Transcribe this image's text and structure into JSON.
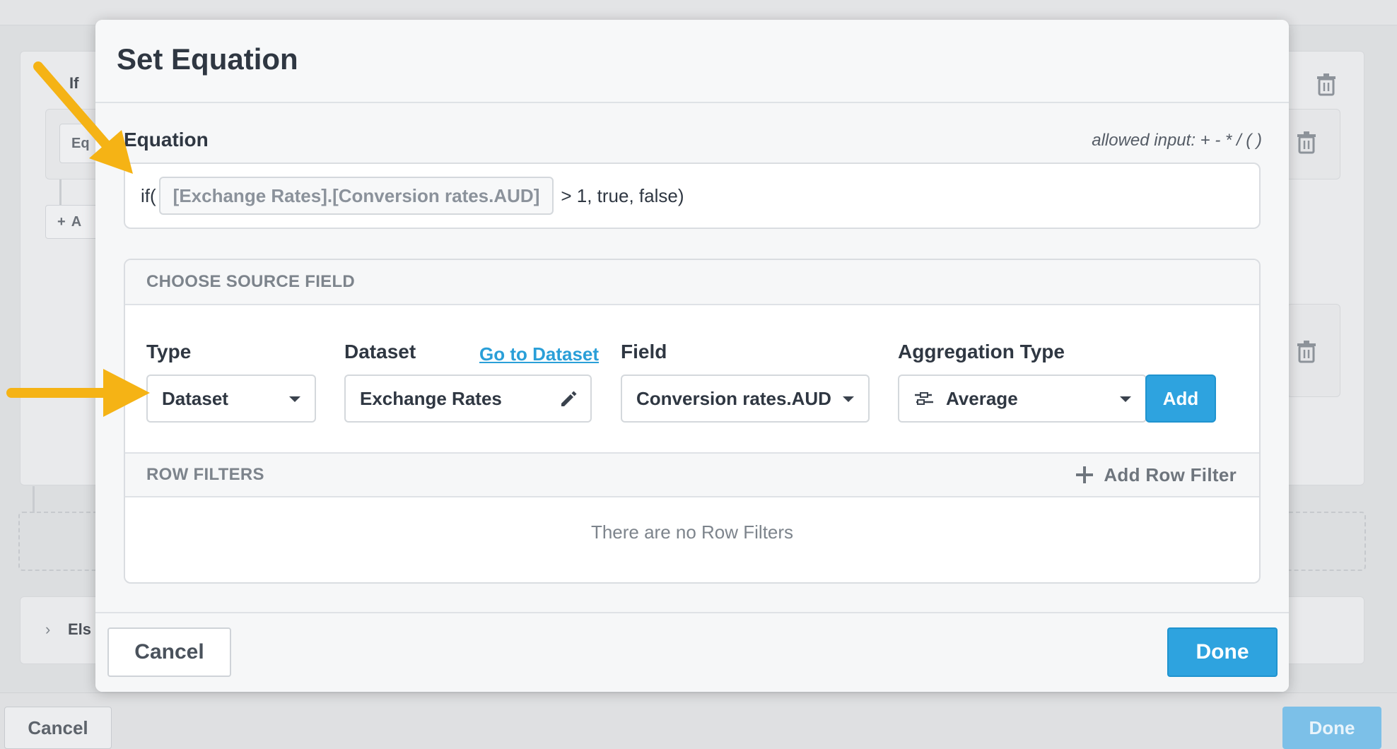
{
  "background": {
    "if_label": "If",
    "eq_field_text": "Eq",
    "add_text": "A",
    "else_label": "Els",
    "cancel_label": "Cancel",
    "done_label": "Done"
  },
  "modal": {
    "title": "Set Equation",
    "equation": {
      "label": "Equation",
      "hint": "allowed input: + - * / ( )",
      "prefix": "if(",
      "token": "[Exchange Rates].[Conversion rates.AUD]",
      "suffix": "> 1, true, false)"
    },
    "source": {
      "section_title": "CHOOSE SOURCE FIELD",
      "type_label": "Type",
      "type_value": "Dataset",
      "dataset_label": "Dataset",
      "goto_link": "Go to Dataset",
      "dataset_value": "Exchange Rates",
      "field_label": "Field",
      "field_value": "Conversion rates.AUD",
      "aggregation_label": "Aggregation Type",
      "aggregation_value": "Average",
      "add_button": "Add"
    },
    "row_filters": {
      "section_title": "ROW FILTERS",
      "add_label": "Add Row Filter",
      "empty_text": "There are no Row Filters"
    },
    "footer": {
      "cancel_label": "Cancel",
      "done_label": "Done"
    }
  },
  "colors": {
    "accent": "#2ea3df",
    "link": "#2a9fd8",
    "arrow": "#f5b315"
  },
  "icons": [
    "trash-icon",
    "pencil-icon",
    "caret-down-icon",
    "aggregation-icon",
    "plus-icon",
    "arrow-annotation-icon"
  ]
}
